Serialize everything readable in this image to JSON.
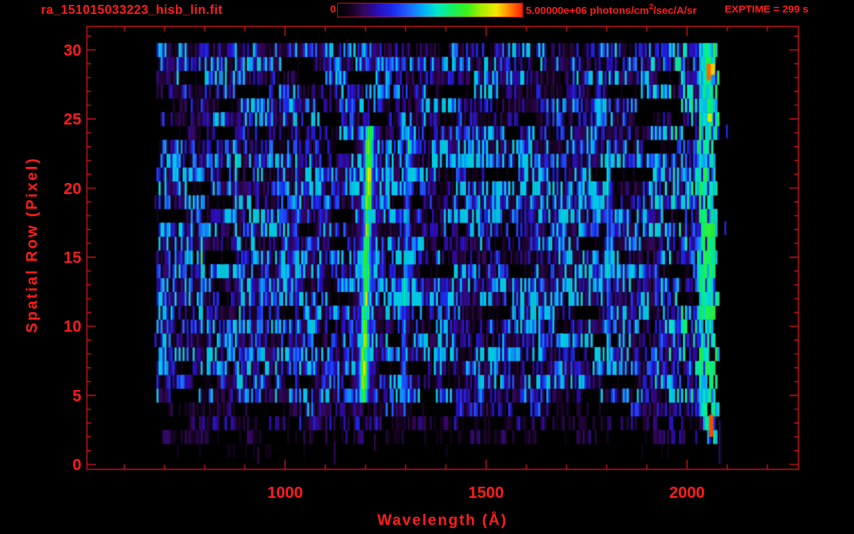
{
  "header": {
    "title": "ra_151015033223_hisb_lin.fit",
    "colorbar": {
      "min_label": "0",
      "max_label_main": "5.00000e+06 photons/cm",
      "max_label_sup": "2",
      "max_label_tail": "/sec/A/sr"
    },
    "exptime_label": "EXPTIME = 299 s"
  },
  "chart_data": {
    "type": "heatmap",
    "title": "ra_151015033223_hisb_lin.fit",
    "xlabel": "Wavelength (Å)",
    "ylabel": "Spatial Row (Pixel)",
    "xlim": [
      507,
      2277
    ],
    "ylim": [
      -0.35,
      31.7
    ],
    "x_major_ticks": [
      1000,
      1500,
      2000
    ],
    "x_tick_labels": [
      "1000",
      "1500",
      "2000"
    ],
    "x_minor_step": 100,
    "y_major_ticks": [
      0,
      5,
      10,
      15,
      20,
      25,
      30
    ],
    "y_tick_labels": [
      "0",
      "5",
      "10",
      "15",
      "20",
      "25",
      "30"
    ],
    "y_minor_step": 1,
    "grid": false,
    "colorbar": {
      "min": 0,
      "max": 5000000,
      "units": "photons/cm2/sec/A/sr",
      "position": "top"
    },
    "exptime_s": 299,
    "colors": {
      "background": "#000000",
      "text": "#ff1c1c",
      "frame": "#cd1414"
    },
    "colormap_stops": [
      [
        0.0,
        "#000000"
      ],
      [
        0.07,
        "#160322"
      ],
      [
        0.14,
        "#35075c"
      ],
      [
        0.21,
        "#2a0bb4"
      ],
      [
        0.3,
        "#1b2cee"
      ],
      [
        0.38,
        "#2063ff"
      ],
      [
        0.47,
        "#00b4f5"
      ],
      [
        0.54,
        "#00e8c8"
      ],
      [
        0.61,
        "#10ef6a"
      ],
      [
        0.7,
        "#3cf01c"
      ],
      [
        0.78,
        "#a8ee00"
      ],
      [
        0.86,
        "#f4e800"
      ],
      [
        0.93,
        "#ff8400"
      ],
      [
        1.0,
        "#ff1e00"
      ]
    ],
    "data_extent": {
      "wavelength": [
        675,
        2080
      ],
      "rows": [
        0,
        30
      ]
    },
    "bin_width_angstrom": 5,
    "row_base_intensity": [
      0.0,
      0.02,
      0.06,
      0.1,
      0.16,
      0.26,
      0.3,
      0.34,
      0.38,
      0.36,
      0.34,
      0.33,
      0.36,
      0.42,
      0.38,
      0.33,
      0.32,
      0.34,
      0.42,
      0.36,
      0.35,
      0.37,
      0.36,
      0.34,
      0.28,
      0.24,
      0.27,
      0.28,
      0.3,
      0.28,
      0.26
    ],
    "emission_lines": [
      {
        "wavelength": 790,
        "width": 7,
        "rows": [
          13,
          17
        ],
        "intensity": 0.5,
        "hot_rows": [
          [
            14,
            16
          ]
        ],
        "hot_boost": 1.15,
        "tilt": 0
      },
      {
        "wavelength": 874,
        "width": 6,
        "rows": [
          17,
          23
        ],
        "intensity": 0.42,
        "hot_rows": [
          [
            20,
            22
          ]
        ],
        "hot_boost": 1.2,
        "tilt": 0
      },
      {
        "wavelength": 1026,
        "width": 6,
        "rows": [
          5,
          24
        ],
        "intensity": 0.34,
        "hot_rows": [
          [
            14,
            15
          ],
          [
            20,
            22
          ]
        ],
        "hot_boost": 1.5,
        "tilt": 0
      },
      {
        "wavelength": 1086,
        "width": 5,
        "rows": [
          17,
          22
        ],
        "intensity": 0.3,
        "hot_rows": [],
        "hot_boost": 1.0,
        "tilt": 0
      },
      {
        "wavelength": 1200,
        "width": 48,
        "rows": [
          5,
          24
        ],
        "intensity": 0.26,
        "hot_rows": [],
        "hot_boost": 1.0,
        "tilt": 0.8
      },
      {
        "wavelength": 1200,
        "width": 20,
        "rows": [
          5,
          24
        ],
        "intensity": 0.68,
        "hot_rows": [
          [
            6,
            8
          ],
          [
            19,
            23
          ]
        ],
        "hot_boost": 1.18,
        "tilt": 0.8
      },
      {
        "wavelength": 1298,
        "width": 11,
        "rows": [
          5,
          23
        ],
        "intensity": 0.4,
        "hot_rows": [
          [
            12,
            15
          ],
          [
            20,
            23
          ]
        ],
        "hot_boost": 1.25,
        "tilt": 0.8
      },
      {
        "wavelength": 1597,
        "width": 6,
        "rows": [
          17,
          22
        ],
        "intensity": 0.26,
        "hot_rows": [],
        "hot_boost": 1.0,
        "tilt": 0
      },
      {
        "wavelength": 1802,
        "width": 8,
        "rows": [
          7,
          23
        ],
        "intensity": 0.42,
        "hot_rows": [
          [
            7,
            9
          ],
          [
            14,
            16
          ],
          [
            20,
            22
          ]
        ],
        "hot_boost": 1.3,
        "tilt": 0
      }
    ],
    "edge_glow": {
      "wavelength_range": [
        2028,
        2076
      ],
      "rows": [
        2,
        30
      ],
      "intensity": 0.5,
      "speckle_from": 1890
    },
    "hot_spots": [
      {
        "wavelength": 2060,
        "rows": [
          2.0,
          3.6
        ],
        "value": 0.97
      },
      {
        "wavelength": 2054,
        "rows": [
          27.8,
          29.0
        ],
        "value": 0.95
      },
      {
        "wavelength": 2064,
        "rows": [
          28.2,
          29.0
        ],
        "value": 0.88
      },
      {
        "wavelength": 2056,
        "rows": [
          24.8,
          25.4
        ],
        "value": 0.83
      }
    ],
    "faint_marks": [
      {
        "wavelength": 931,
        "rows": [
          0.0,
          1.3
        ],
        "value": 0.13
      },
      {
        "wavelength": 1121,
        "rows": [
          0.0,
          1.6
        ],
        "value": 0.14
      },
      {
        "wavelength": 1221,
        "rows": [
          1.0,
          2.2
        ],
        "value": 0.13
      },
      {
        "wavelength": 2079,
        "rows": [
          0.0,
          3.2
        ],
        "value": 0.15
      },
      {
        "wavelength": 2093,
        "rows": [
          16.6,
          17.6
        ],
        "value": 0.3
      },
      {
        "wavelength": 2097,
        "rows": [
          23.6,
          24.6
        ],
        "value": 0.3
      }
    ]
  }
}
